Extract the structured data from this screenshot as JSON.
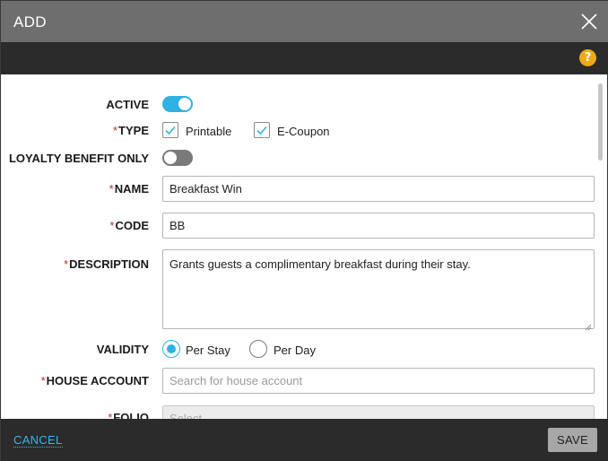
{
  "dialog": {
    "title": "ADD",
    "close_icon": "close-icon",
    "help_label": "?"
  },
  "form": {
    "active": {
      "label": "ACTIVE",
      "value": true
    },
    "type": {
      "label": "TYPE",
      "required": true,
      "options": [
        {
          "label": "Printable",
          "checked": true
        },
        {
          "label": "E-Coupon",
          "checked": true
        }
      ]
    },
    "loyalty_benefit_only": {
      "label": "LOYALTY BENEFIT ONLY",
      "value": false
    },
    "name": {
      "label": "NAME",
      "required": true,
      "value": "Breakfast Win"
    },
    "code": {
      "label": "CODE",
      "required": true,
      "value": "BB"
    },
    "description": {
      "label": "DESCRIPTION",
      "required": true,
      "value": "Grants guests a complimentary breakfast during their stay."
    },
    "validity": {
      "label": "VALIDITY",
      "options": [
        {
          "label": "Per Stay",
          "selected": true
        },
        {
          "label": "Per Day",
          "selected": false
        }
      ]
    },
    "house_account": {
      "label": "HOUSE ACCOUNT",
      "required": true,
      "placeholder": "Search for house account",
      "value": ""
    },
    "folio": {
      "label": "FOLIO",
      "required": true,
      "placeholder": "Select"
    },
    "required_marker": "*"
  },
  "footer": {
    "cancel_label": "CANCEL",
    "save_label": "SAVE"
  },
  "colors": {
    "accent": "#2fb2e2",
    "required": "#d0242b",
    "help": "#f0a915",
    "header_bg": "#6e6e6e",
    "bar_bg": "#2b2b2b"
  }
}
